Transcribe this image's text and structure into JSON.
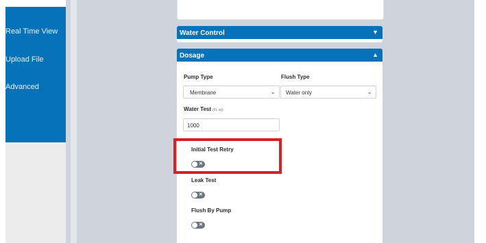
{
  "sidebar": {
    "items": [
      {
        "label": "Real Time View"
      },
      {
        "label": "Upload File"
      },
      {
        "label": "Advanced"
      }
    ]
  },
  "panels": {
    "water_control": {
      "title": "Water Control",
      "arrow": "▼"
    },
    "dosage": {
      "title": "Dosage",
      "arrow": "▲"
    }
  },
  "dosage": {
    "pump_type": {
      "label": "Pump Type",
      "value": "Membrane"
    },
    "flush_type": {
      "label": "Flush Type",
      "value": "Water only"
    },
    "water_test": {
      "label": "Water Test",
      "unit": "(FL oz)",
      "value": "1000"
    },
    "toggles": [
      {
        "label": "Initial Test Retry",
        "state": "off"
      },
      {
        "label": "Leak Test",
        "state": "off"
      },
      {
        "label": "Flush By Pump",
        "state": "off"
      }
    ]
  },
  "icons": {
    "dropdown": "chevron-down-icon",
    "toggle_off": "x-icon"
  },
  "colors": {
    "primary": "#0672b9",
    "highlight": "#d71f26",
    "toggle_off": "#6c757d"
  }
}
